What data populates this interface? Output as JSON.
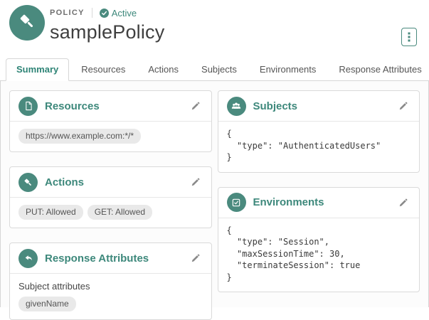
{
  "header": {
    "type_label": "POLICY",
    "status": "Active",
    "title": "samplePolicy"
  },
  "tabs": [
    {
      "label": "Summary",
      "active": true
    },
    {
      "label": "Resources",
      "active": false
    },
    {
      "label": "Actions",
      "active": false
    },
    {
      "label": "Subjects",
      "active": false
    },
    {
      "label": "Environments",
      "active": false
    },
    {
      "label": "Response Attributes",
      "active": false
    }
  ],
  "cards": {
    "resources": {
      "title": "Resources",
      "chips": [
        "https://www.example.com:*/*"
      ]
    },
    "actions": {
      "title": "Actions",
      "chips": [
        "PUT: Allowed",
        "GET: Allowed"
      ]
    },
    "response_attributes": {
      "title": "Response Attributes",
      "subtitle": "Subject attributes",
      "chips": [
        "givenName"
      ]
    },
    "subjects": {
      "title": "Subjects",
      "code": "{\n  \"type\": \"AuthenticatedUsers\"\n}"
    },
    "environments": {
      "title": "Environments",
      "code": "{\n  \"type\": \"Session\",\n  \"maxSessionTime\": 30,\n  \"terminateSession\": true\n}"
    }
  },
  "colors": {
    "accent_teal": "#4a8a7e",
    "accent_teal_text": "#3d887b",
    "chip_background": "#e9e9e9",
    "panel_background": "#fcfcfc",
    "border": "#d6d6d6"
  }
}
